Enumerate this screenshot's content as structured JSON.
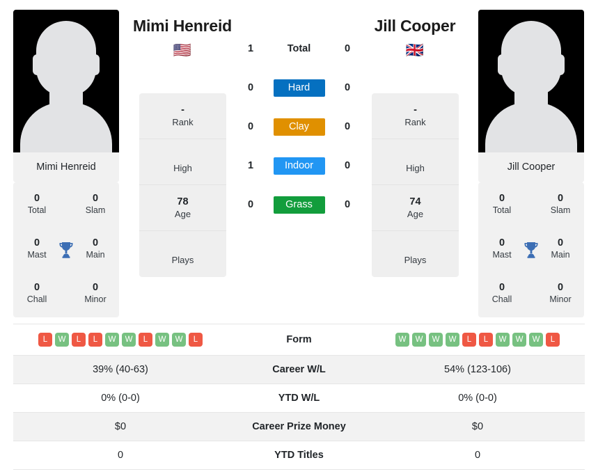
{
  "players": {
    "left": {
      "name": "Mimi Henreid",
      "photo_caption": "Mimi Henreid",
      "flag": "🇺🇸",
      "flag_name": "usa-flag",
      "info": [
        {
          "value": "-",
          "label": "Rank"
        },
        {
          "value": "",
          "label": "High"
        },
        {
          "value": "78",
          "label": "Age"
        },
        {
          "value": "",
          "label": "Plays"
        }
      ],
      "titles": [
        {
          "num": "0",
          "label": "Total"
        },
        {
          "num": "0",
          "label": "Slam"
        },
        {
          "num": "0",
          "label": "Mast"
        },
        {
          "num": "0",
          "label": "Main"
        },
        {
          "num": "0",
          "label": "Chall"
        },
        {
          "num": "0",
          "label": "Minor"
        }
      ],
      "form": [
        "L",
        "W",
        "L",
        "L",
        "W",
        "W",
        "L",
        "W",
        "W",
        "L"
      ],
      "career_wl": "39% (40-63)",
      "ytd_wl": "0% (0-0)",
      "career_prize_money": "$0",
      "ytd_titles": "0"
    },
    "right": {
      "name": "Jill Cooper",
      "photo_caption": "Jill Cooper",
      "flag": "🇬🇧",
      "flag_name": "uk-flag",
      "info": [
        {
          "value": "-",
          "label": "Rank"
        },
        {
          "value": "",
          "label": "High"
        },
        {
          "value": "74",
          "label": "Age"
        },
        {
          "value": "",
          "label": "Plays"
        }
      ],
      "titles": [
        {
          "num": "0",
          "label": "Total"
        },
        {
          "num": "0",
          "label": "Slam"
        },
        {
          "num": "0",
          "label": "Mast"
        },
        {
          "num": "0",
          "label": "Main"
        },
        {
          "num": "0",
          "label": "Chall"
        },
        {
          "num": "0",
          "label": "Minor"
        }
      ],
      "form": [
        "W",
        "W",
        "W",
        "W",
        "L",
        "L",
        "W",
        "W",
        "W",
        "L"
      ],
      "career_wl": "54% (123-106)",
      "ytd_wl": "0% (0-0)",
      "career_prize_money": "$0",
      "ytd_titles": "0"
    }
  },
  "head_to_head": {
    "total": {
      "left": "1",
      "label": "Total",
      "right": "0"
    },
    "surfaces": [
      {
        "left": "0",
        "label": "Hard",
        "right": "0",
        "color": "#0570c0"
      },
      {
        "left": "0",
        "label": "Clay",
        "right": "0",
        "color": "#e09000"
      },
      {
        "left": "1",
        "label": "Indoor",
        "right": "0",
        "color": "#2196f3"
      },
      {
        "left": "0",
        "label": "Grass",
        "right": "0",
        "color": "#129d3c"
      }
    ]
  },
  "comparison_rows": {
    "form_label": "Form",
    "career_wl_label": "Career W/L",
    "ytd_wl_label": "YTD W/L",
    "career_prize_money_label": "Career Prize Money",
    "ytd_titles_label": "YTD Titles"
  },
  "colors": {
    "hard": "#0570c0",
    "clay": "#e09000",
    "indoor": "#2196f3",
    "grass": "#129d3c",
    "win": "#77c181",
    "loss": "#ef5844",
    "trophy": "#3c6eb4",
    "panel_bg": "#f1f1f1"
  }
}
